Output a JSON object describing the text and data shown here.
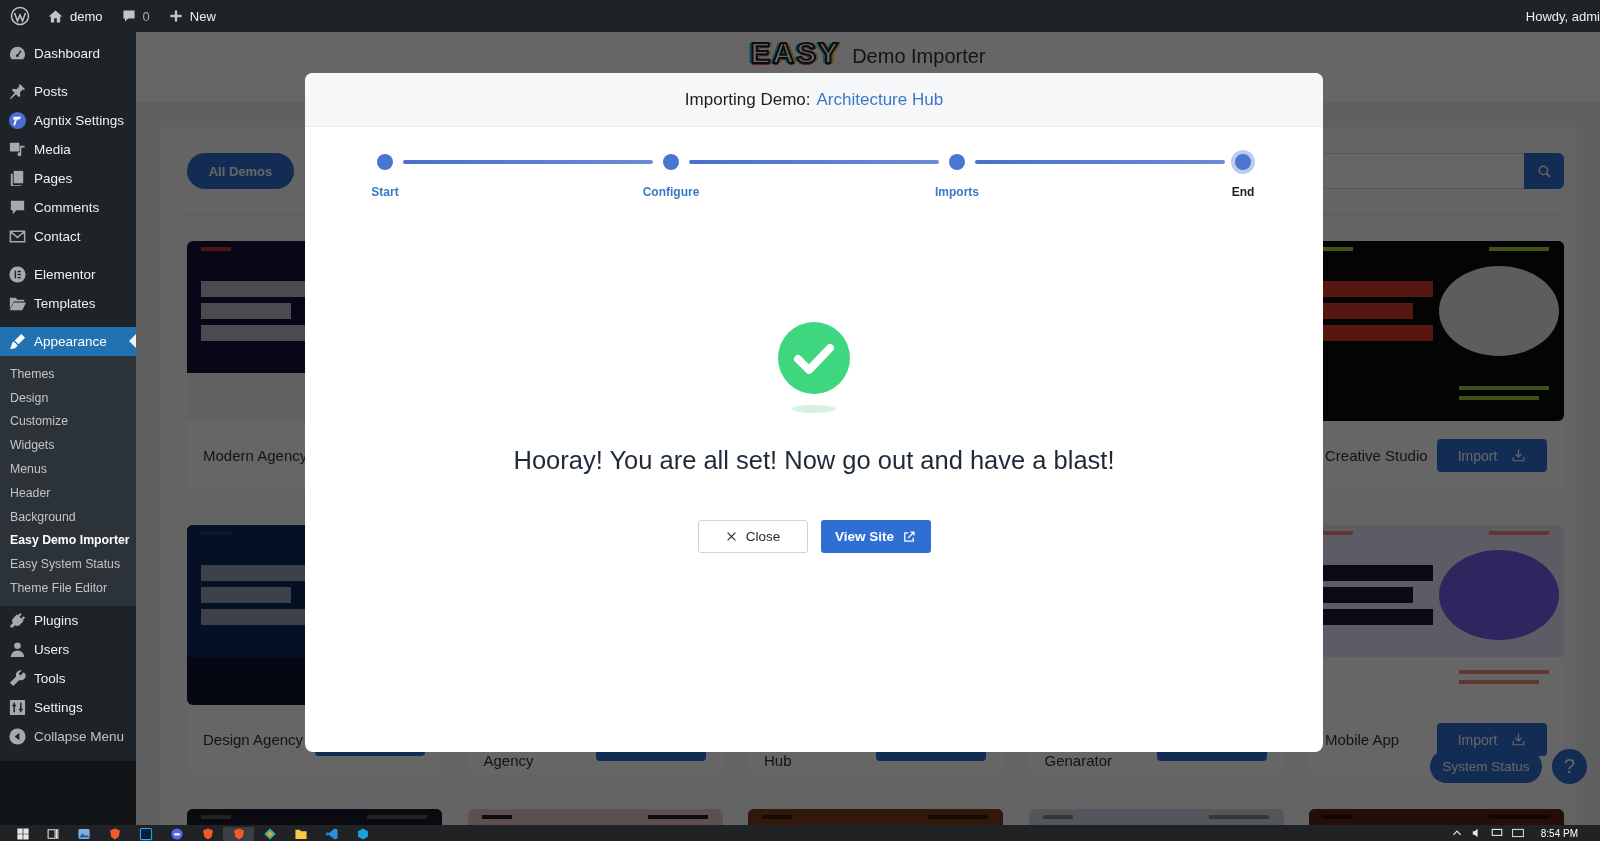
{
  "admin_bar": {
    "site": "demo",
    "comments": "0",
    "new": "New",
    "greeting": "Howdy, admi"
  },
  "sidebar": {
    "items": [
      {
        "label": "Dashboard",
        "selected": false
      },
      {
        "label": "Posts",
        "selected": false
      },
      {
        "label": "Agntix Settings",
        "selected": false
      },
      {
        "label": "Media",
        "selected": false
      },
      {
        "label": "Pages",
        "selected": false
      },
      {
        "label": "Comments",
        "selected": false
      },
      {
        "label": "Contact",
        "selected": false
      },
      {
        "label": "Elementor",
        "selected": false
      },
      {
        "label": "Templates",
        "selected": false
      },
      {
        "label": "Appearance",
        "selected": true,
        "children": [
          {
            "label": "Themes",
            "selected": false
          },
          {
            "label": "Design",
            "selected": false
          },
          {
            "label": "Customize",
            "selected": false
          },
          {
            "label": "Widgets",
            "selected": false
          },
          {
            "label": "Menus",
            "selected": false
          },
          {
            "label": "Header",
            "selected": false
          },
          {
            "label": "Background",
            "selected": false
          },
          {
            "label": "Easy Demo Importer",
            "selected": true
          },
          {
            "label": "Easy System Status",
            "selected": false
          },
          {
            "label": "Theme File Editor",
            "selected": false
          }
        ]
      },
      {
        "label": "Plugins",
        "selected": false
      },
      {
        "label": "Users",
        "selected": false
      },
      {
        "label": "Tools",
        "selected": false
      },
      {
        "label": "Settings",
        "selected": false
      }
    ],
    "collapse": "Collapse Menu"
  },
  "importer": {
    "logo": "EASY",
    "title": "Demo Importer",
    "filter": "All Demos",
    "rows": [
      {
        "cards": [
          {
            "kind": "full",
            "title": "Modern Agency",
            "has_import": false
          },
          {
            "kind": "hidden"
          },
          {
            "kind": "hidden"
          },
          {
            "kind": "hidden"
          },
          {
            "kind": "full",
            "title": "Creative Studio",
            "has_import": true,
            "import": "Import"
          }
        ]
      },
      {
        "cards": [
          {
            "kind": "full",
            "title": "Design Agency",
            "has_import": true
          },
          {
            "kind": "covered",
            "title": "Agency",
            "has_import": true
          },
          {
            "kind": "covered",
            "title": "Hub",
            "has_import": true
          },
          {
            "kind": "covered",
            "title": "Genarator",
            "has_import": true
          },
          {
            "kind": "full",
            "title": "Mobile App",
            "has_import": true,
            "import": "Import"
          }
        ]
      },
      {
        "cards": [
          {
            "kind": "peek"
          },
          {
            "kind": "peek"
          },
          {
            "kind": "peek"
          },
          {
            "kind": "peek"
          },
          {
            "kind": "peek"
          }
        ]
      }
    ],
    "system_status": "System Status",
    "help": "?"
  },
  "modal": {
    "title": "Importing Demo:",
    "demo": "Architecture Hub",
    "steps": [
      {
        "label": "Start",
        "current": false
      },
      {
        "label": "Configure",
        "current": false
      },
      {
        "label": "Imports",
        "current": false
      },
      {
        "label": "End",
        "current": true
      }
    ],
    "message": "Hooray! You are all set! Now go out and have a blast!",
    "buttons": [
      {
        "label": "Close",
        "kind": "close"
      },
      {
        "label": "View Site",
        "kind": "primary"
      }
    ]
  },
  "taskbar": {
    "apps": [
      {
        "selected": false
      },
      {
        "selected": false
      },
      {
        "selected": false
      },
      {
        "selected": false
      },
      {
        "selected": false
      },
      {
        "selected": true
      },
      {
        "selected": false
      },
      {
        "selected": false
      },
      {
        "selected": false
      },
      {
        "selected": false
      }
    ],
    "clock": "8:54 PM"
  }
}
